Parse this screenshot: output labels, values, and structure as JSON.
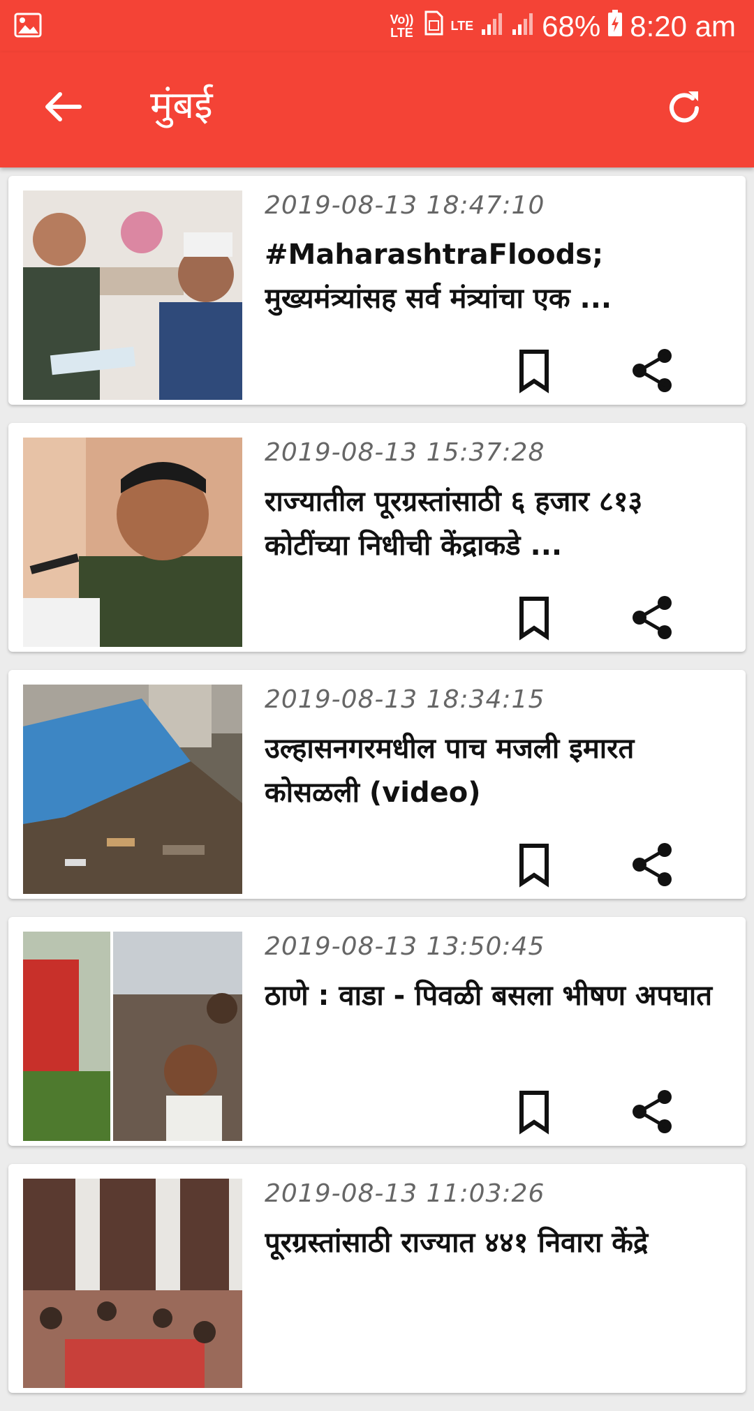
{
  "status_bar": {
    "volte_label": "Vo)) LTE",
    "lte_label": "LTE",
    "battery": "68%",
    "time": "8:20 am"
  },
  "toolbar": {
    "title": "मुंबई",
    "back_icon": "arrow-back-icon",
    "refresh_icon": "refresh-icon"
  },
  "articles": [
    {
      "date": "2019-08-13 18:47:10",
      "headline": "#MaharashtraFloods; मुख्यमंत्र्यांसह सर्व मंत्र्यांचा एक ...",
      "image": "two-men-cheque-photo"
    },
    {
      "date": "2019-08-13 15:37:28",
      "headline": "राज्यातील पूरग्रस्तांसाठी ६ हजार ८१३ कोटींच्या निधीची केंद्राकडे ...",
      "image": "man-speaking-photo"
    },
    {
      "date": "2019-08-13 18:34:15",
      "headline": "उल्हासनगरमधील पाच मजली इमारत कोसळली (video)",
      "image": "collapsed-building-photo"
    },
    {
      "date": "2019-08-13 13:50:45",
      "headline": "ठाणे : वाडा - पिवळी बसला भीषण अपघात",
      "image": "bus-accident-photo"
    },
    {
      "date": "2019-08-13 11:03:26",
      "headline": "पूरग्रस्तांसाठी राज्यात ४४१ निवारा केंद्रे",
      "image": "relief-shelter-photo"
    }
  ],
  "colors": {
    "app_bar": "#f44336",
    "background": "#ececec",
    "card": "#ffffff",
    "date_text": "#666666",
    "headline_text": "#111111"
  }
}
